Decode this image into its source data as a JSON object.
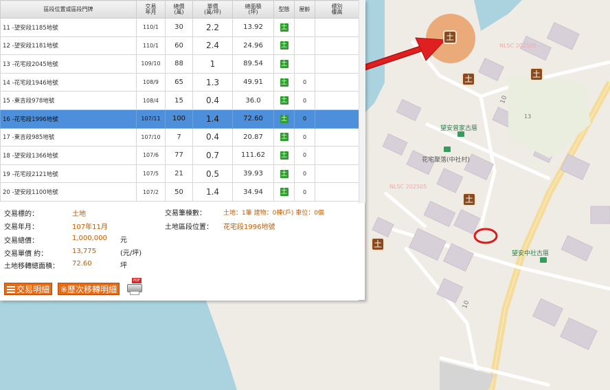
{
  "table": {
    "headers": {
      "address": "區段位置或區段門牌",
      "date": "交易\n年月",
      "total": "總價\n(萬)",
      "unit": "單價\n(萬/坪)",
      "area": "總面積\n(坪)",
      "type": "型態",
      "age": "屋齡",
      "floor": "標別\n樓高"
    },
    "rows": [
      {
        "addr": "11 -望安段1185地號",
        "date": "110/1",
        "total": "30",
        "unit": "2.2",
        "area": "13.92",
        "type_icon": "土",
        "age": ""
      },
      {
        "addr": "12 -望安段1181地號",
        "date": "110/1",
        "total": "60",
        "unit": "2.4",
        "area": "24.96",
        "type_icon": "土",
        "age": ""
      },
      {
        "addr": "13 -花宅段2045地號",
        "date": "109/10",
        "total": "88",
        "unit": "1",
        "area": "89.54",
        "type_icon": "土",
        "age": ""
      },
      {
        "addr": "14 -花宅段1946地號",
        "date": "108/9",
        "total": "65",
        "unit": "1.3",
        "area": "49.91",
        "type_icon": "土",
        "age": "0"
      },
      {
        "addr": "15 -東吉段978地號",
        "date": "108/4",
        "total": "15",
        "unit": "0.4",
        "area": "36.0",
        "type_icon": "土",
        "age": "0"
      },
      {
        "addr": "16 -花宅段1996地號",
        "date": "107/11",
        "total": "100",
        "unit": "1.4",
        "area": "72.60",
        "type_icon": "土",
        "age": "0",
        "selected": true
      },
      {
        "addr": "17 -東吉段985地號",
        "date": "107/10",
        "total": "7",
        "unit": "0.4",
        "area": "20.87",
        "type_icon": "土",
        "age": "0"
      },
      {
        "addr": "18 -望安段1366地號",
        "date": "107/6",
        "total": "77",
        "unit": "0.7",
        "area": "111.62",
        "type_icon": "土",
        "age": "0"
      },
      {
        "addr": "19 -花宅段2121地號",
        "date": "107/5",
        "total": "21",
        "unit": "0.5",
        "area": "39.93",
        "type_icon": "土",
        "age": "0"
      },
      {
        "addr": "20 -望安段1100地號",
        "date": "107/2",
        "total": "50",
        "unit": "1.4",
        "area": "34.94",
        "type_icon": "土",
        "age": "0"
      }
    ]
  },
  "details": {
    "target_label": "交易標的：",
    "target_value": "土地",
    "date_label": "交易年月：",
    "date_value": "107年11月",
    "total_label": "交易總價：",
    "total_value": "1,000,000",
    "total_unit": "元",
    "unitprice_label": "交易單價 約：",
    "unitprice_value": "13,775",
    "unitprice_unit": "(元/坪)",
    "area_label": "土地移轉總面積：",
    "area_value": "72.60",
    "area_unit": "坪",
    "count_label": "交易筆棟數：",
    "count_value": "土地：1筆 建物：0棟(戶) 車位：0個",
    "location_label": "土地區段位置：",
    "location_value": "花宅段1996地號"
  },
  "buttons": {
    "detail": "交易明細",
    "history": "※歷次移轉明細",
    "pdf_badge": "PDF"
  },
  "map": {
    "labels": {
      "nlsc1": "NLSC 202505",
      "nlsc2": "NLSC 202505",
      "temple1": "望安曾家古厝",
      "village": "花宅聚落(中社村)",
      "temple2": "望安中社古厝",
      "road1": "10",
      "road2": "10",
      "peak": "13",
      "marker": "土"
    }
  },
  "colors": {
    "selected_row": "#4d8fda",
    "land_icon": "#2f9e2f",
    "accent_orange": "#e76a14",
    "value_text": "#c25a00",
    "water": "#aad3df",
    "arrow": "#e02020"
  }
}
